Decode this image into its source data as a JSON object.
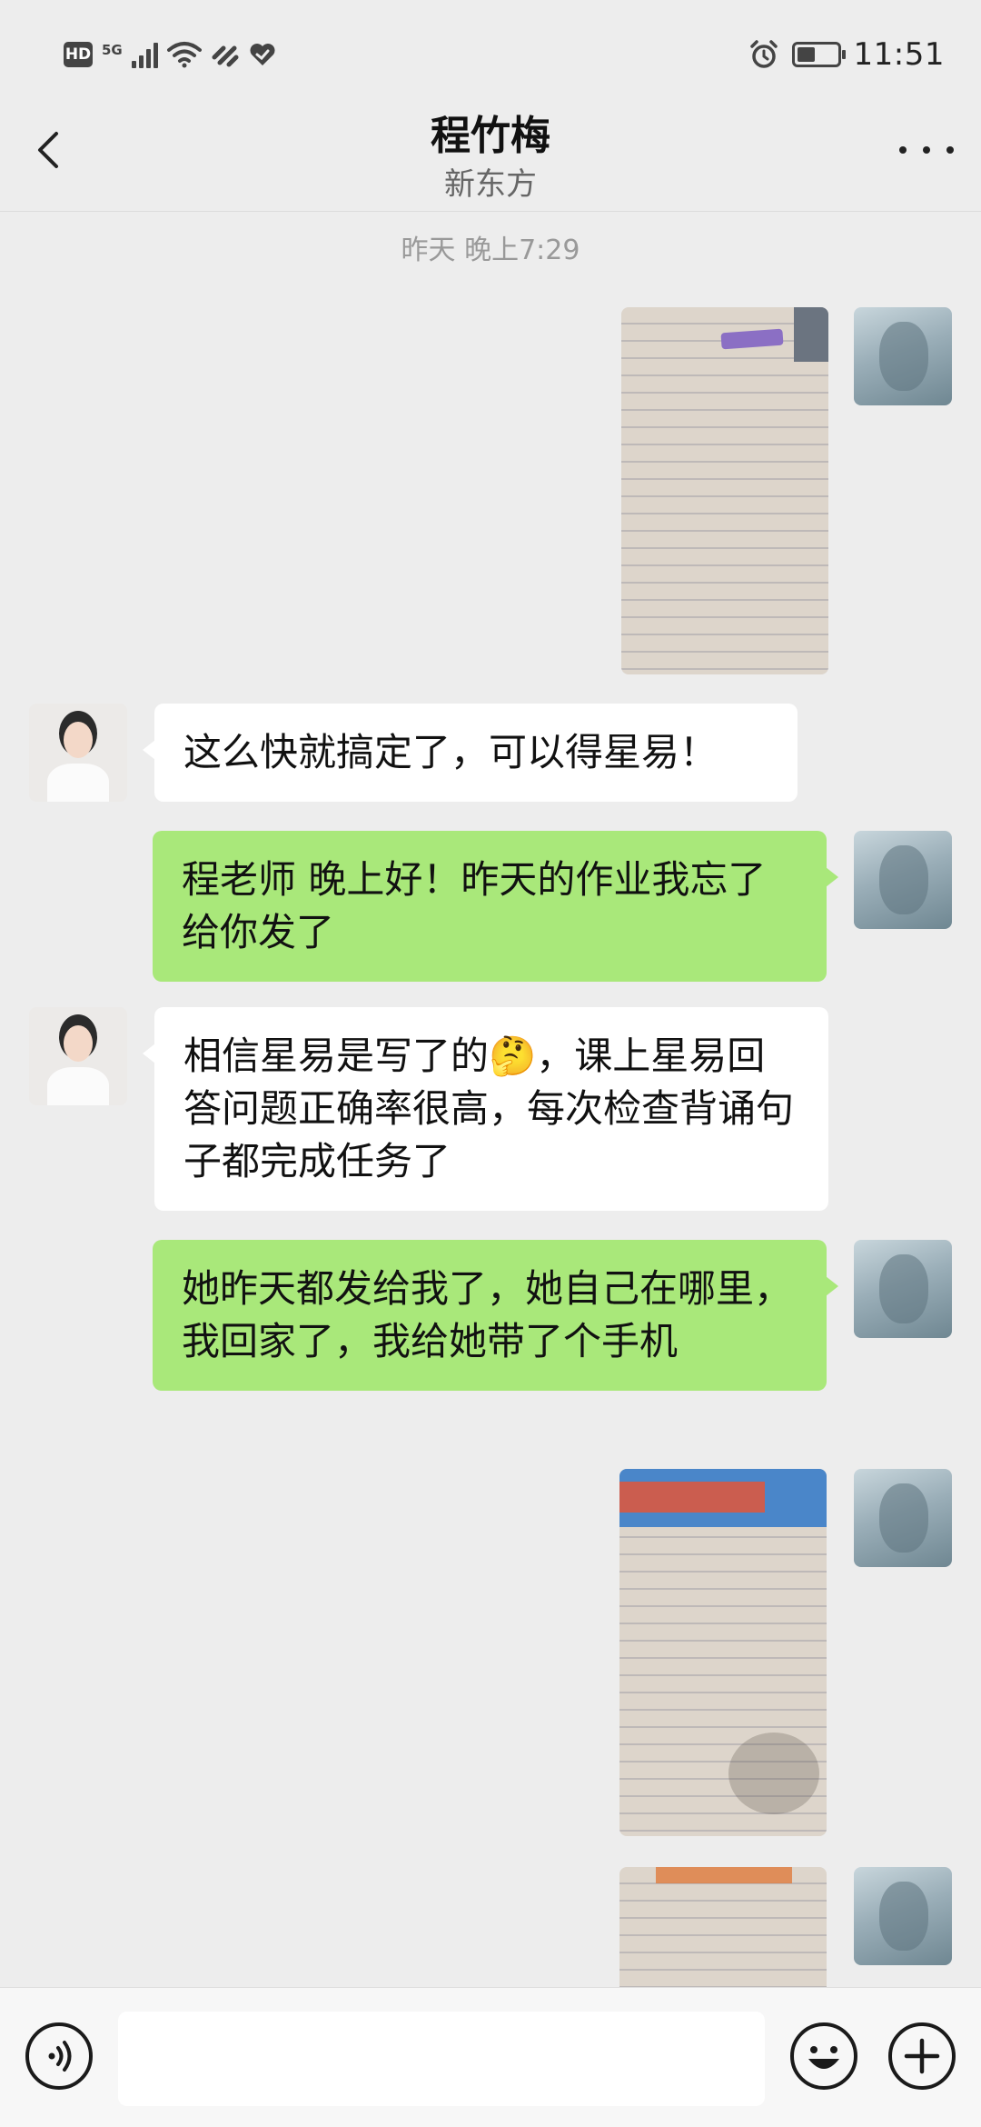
{
  "status_bar": {
    "hd_label": "HD",
    "network_label": "5G",
    "time": "11:51",
    "battery_level": 0.45
  },
  "header": {
    "title": "程竹梅",
    "subtitle": "新东方"
  },
  "timestamp": "昨天 晚上7:29",
  "messages": [
    {
      "sender": "me",
      "type": "image",
      "content": "photo of handwritten notebook page"
    },
    {
      "sender": "other",
      "type": "text",
      "text": "这么快就搞定了，可以得星易！"
    },
    {
      "sender": "me",
      "type": "text",
      "text": "程老师  晚上好！昨天的作业我忘了给你发了"
    },
    {
      "sender": "other",
      "type": "text",
      "text": "相信星易是写了的🤔，课上星易回答问题正确率很高，每次检查背诵句子都完成任务了"
    },
    {
      "sender": "me",
      "type": "text",
      "text": "她昨天都发给我了，她自己在哪里， 我回家了，我给她带了个手机"
    },
    {
      "sender": "me",
      "type": "image",
      "content": "photo of handwritten notebook page"
    },
    {
      "sender": "me",
      "type": "image",
      "content": "photo of handwritten notebook page"
    }
  ],
  "input_bar": {
    "voice_icon": "voice-icon",
    "emoji_icon": "emoji-icon",
    "plus_icon": "plus-icon",
    "value": ""
  },
  "colors": {
    "background": "#ededed",
    "bubble_self": "#a9e87a",
    "bubble_other": "#ffffff"
  }
}
